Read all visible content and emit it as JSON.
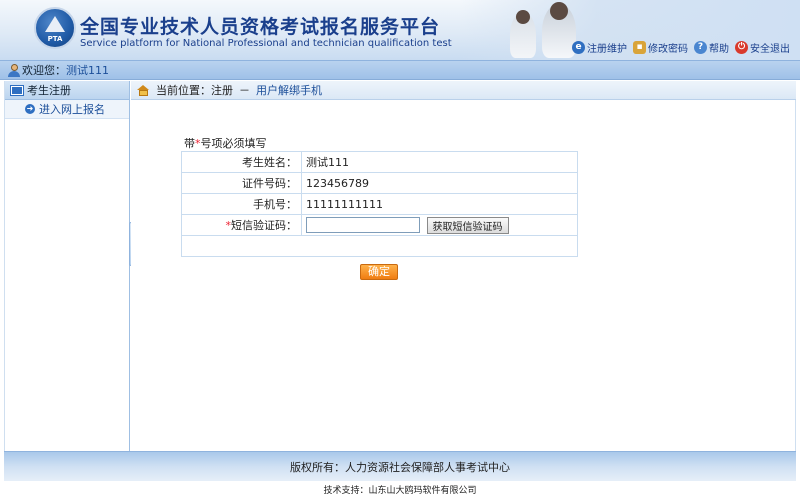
{
  "header": {
    "title_cn": "全国专业技术人员资格考试报名服务平台",
    "title_en": "Service platform for National Professional and technician qualification test",
    "logo_text": "PTA",
    "links": [
      {
        "label": "注册维护",
        "icon": "globe-icon"
      },
      {
        "label": "修改密码",
        "icon": "lock-icon"
      },
      {
        "label": "帮助",
        "icon": "help-icon"
      },
      {
        "label": "安全退出",
        "icon": "power-icon"
      }
    ]
  },
  "welcome": {
    "prefix": "欢迎您：",
    "user": "测试111"
  },
  "sidebar": {
    "section": "考生注册",
    "items": [
      {
        "label": "进入网上报名"
      }
    ]
  },
  "breadcrumb": {
    "prefix": "当前位置：",
    "root": "注册",
    "sep": "－",
    "current": "用户解绑手机"
  },
  "form": {
    "note_prefix": "带",
    "note_star": "*",
    "note_suffix": "号项必须填写",
    "rows": [
      {
        "label": "考生姓名：",
        "value": "测试111"
      },
      {
        "label": "证件号码：",
        "value": "123456789"
      },
      {
        "label": "手机号：",
        "value": "11111111111"
      }
    ],
    "sms_label": "短信验证码：",
    "sms_star": "*",
    "sms_value": "",
    "sms_button": "获取短信验证码",
    "confirm": "确定"
  },
  "footer": {
    "copyright": "版权所有：人力资源社会保障部人事考试中心",
    "tech": "技术支持：山东山大鸥玛软件有限公司"
  },
  "colors": {
    "accent": "#1b4e99",
    "confirm": "#f07d12",
    "required": "#e22233"
  }
}
